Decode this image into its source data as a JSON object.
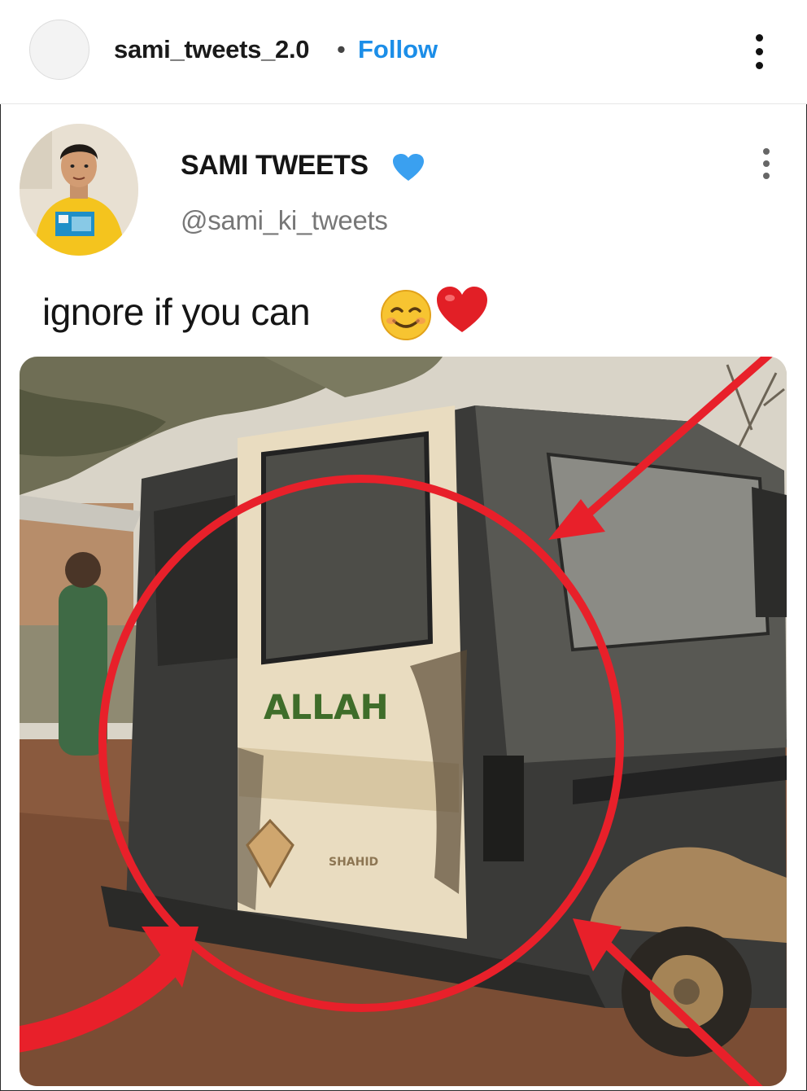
{
  "post": {
    "username": "sami_tweets_2.0",
    "separator": "•",
    "follow_label": "Follow",
    "more_icon": "more-vertical-icon"
  },
  "tweet": {
    "display_name": "SAMI TWEETS",
    "verified_icon": "blue-heart-icon",
    "handle": "@sami_ki_tweets",
    "text": "ignore if you can",
    "emojis": [
      "smiling-face-icon",
      "red-heart-icon"
    ],
    "more_icon": "more-vertical-icon"
  },
  "photo": {
    "door_text": "ALLAH",
    "badge_text": "SHAHID",
    "annotation_color": "#e8202a",
    "annotations": [
      "red-circle",
      "red-arrow-top-right",
      "red-arrow-bottom-right",
      "red-arrow-bottom-left"
    ]
  },
  "colors": {
    "follow": "#1c8ee8",
    "handle": "#777777",
    "annotation": "#e8202a"
  }
}
